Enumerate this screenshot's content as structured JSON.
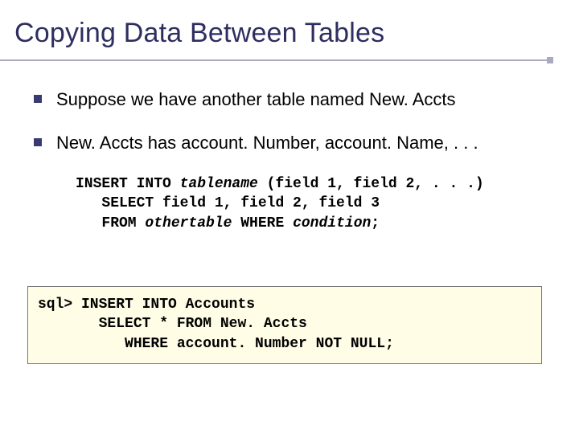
{
  "title": "Copying Data Between Tables",
  "bullets": [
    "Suppose we have another table named New. Accts",
    "New. Accts has account. Number, account. Name, . . ."
  ],
  "code": {
    "l1a": "INSERT INTO ",
    "l1b": "tablename",
    "l1c": " (field 1, field 2, . . .)",
    "l2": "   SELECT field 1, field 2, field 3",
    "l3a": "   FROM ",
    "l3b": "othertable",
    "l3c": " WHERE ",
    "l3d": "condition",
    "l3e": ";"
  },
  "sql": {
    "l1": "sql> INSERT INTO Accounts",
    "l2": "       SELECT * FROM New. Accts",
    "l3": "          WHERE account. Number NOT NULL;"
  }
}
